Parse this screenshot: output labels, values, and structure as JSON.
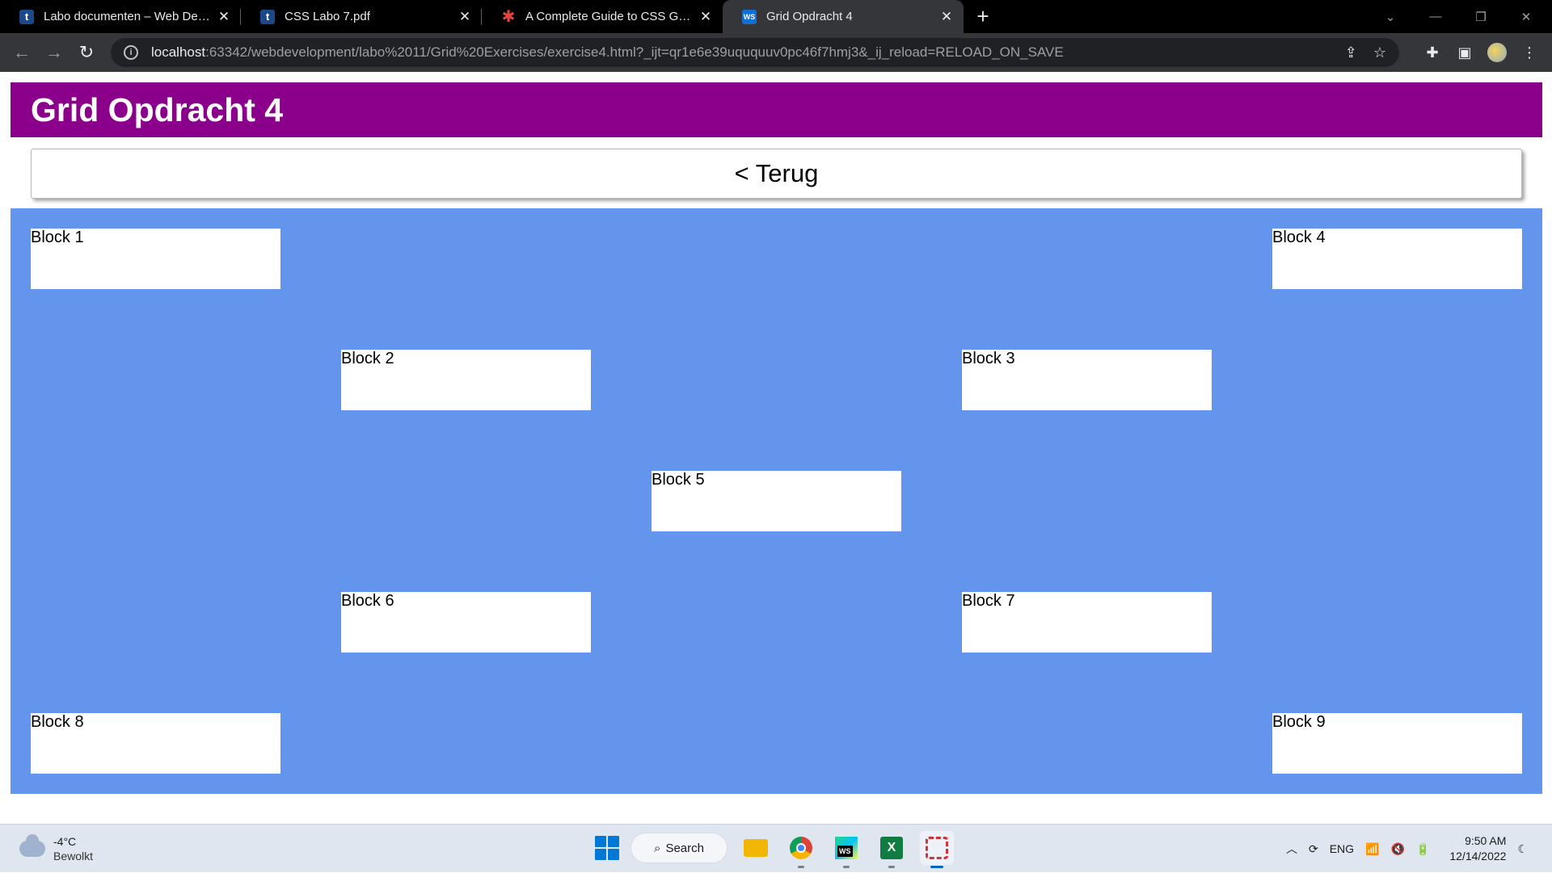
{
  "browser": {
    "tabs": [
      {
        "title": "Labo documenten – Web Development",
        "favicon": "t",
        "active": false
      },
      {
        "title": "CSS Labo 7.pdf",
        "favicon": "t",
        "active": false
      },
      {
        "title": "A Complete Guide to CSS Grid | CSS-Tricks",
        "favicon": "star",
        "active": false
      },
      {
        "title": "Grid Opdracht 4",
        "favicon": "ws",
        "active": true
      }
    ],
    "url_host": "localhost",
    "url_rest": ":63342/webdevelopment/labo%2011/Grid%20Exercises/exercise4.html?_ijt=qr1e6e39uququuv0pc46f7hmj3&_ij_reload=RELOAD_ON_SAVE",
    "icons": {
      "back": "arrow-left-icon",
      "forward": "arrow-right-icon",
      "reload": "reload-icon",
      "share": "share-icon",
      "bookmark": "star-icon",
      "extensions": "puzzle-icon",
      "sidepanel": "sidepanel-icon",
      "menu": "kebab-icon"
    }
  },
  "page": {
    "heading": "Grid Opdracht 4",
    "back_button": "< Terug",
    "blocks": [
      "Block 1",
      "Block 2",
      "Block 3",
      "Block 4",
      "Block 5",
      "Block 6",
      "Block 7",
      "Block 8",
      "Block 9"
    ],
    "colors": {
      "header": "#8b008b",
      "grid_bg": "#6495ed",
      "block_bg": "#ffffff"
    }
  },
  "taskbar": {
    "temperature": "-4°C",
    "weather": "Bewolkt",
    "search_label": "Search",
    "language": "ENG",
    "time": "9:50 AM",
    "date": "12/14/2022"
  }
}
